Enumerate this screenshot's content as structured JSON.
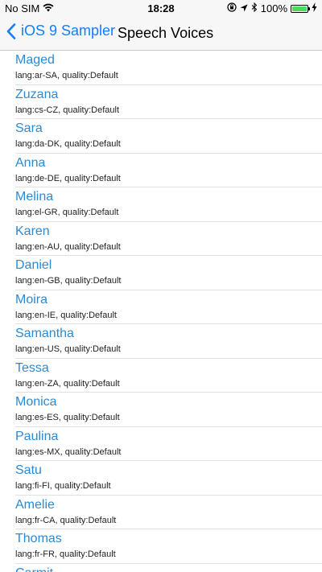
{
  "status": {
    "carrier": "No SIM",
    "time": "18:28",
    "battery": "100%",
    "battery_level": 1.0,
    "icons": [
      "wifi-icon",
      "lock-rotation-icon",
      "location-icon",
      "bluetooth-icon",
      "charging-icon"
    ]
  },
  "nav": {
    "back_label": "iOS 9 Sampler",
    "title": "Speech Voices",
    "accent": "#147efb"
  },
  "voices": [
    {
      "name": "Maged",
      "detail": "lang:ar-SA, quality:Default"
    },
    {
      "name": "Zuzana",
      "detail": "lang:cs-CZ, quality:Default"
    },
    {
      "name": "Sara",
      "detail": "lang:da-DK, quality:Default"
    },
    {
      "name": "Anna",
      "detail": "lang:de-DE, quality:Default"
    },
    {
      "name": "Melina",
      "detail": "lang:el-GR, quality:Default"
    },
    {
      "name": "Karen",
      "detail": "lang:en-AU, quality:Default"
    },
    {
      "name": "Daniel",
      "detail": "lang:en-GB, quality:Default"
    },
    {
      "name": "Moira",
      "detail": "lang:en-IE, quality:Default"
    },
    {
      "name": "Samantha",
      "detail": "lang:en-US, quality:Default"
    },
    {
      "name": "Tessa",
      "detail": "lang:en-ZA, quality:Default"
    },
    {
      "name": "Monica",
      "detail": "lang:es-ES, quality:Default"
    },
    {
      "name": "Paulina",
      "detail": "lang:es-MX, quality:Default"
    },
    {
      "name": "Satu",
      "detail": "lang:fi-FI, quality:Default"
    },
    {
      "name": "Amelie",
      "detail": "lang:fr-CA, quality:Default"
    },
    {
      "name": "Thomas",
      "detail": "lang:fr-FR, quality:Default"
    },
    {
      "name": "Carmit",
      "detail": ""
    }
  ]
}
